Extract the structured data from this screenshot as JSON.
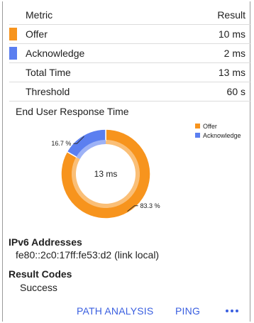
{
  "table": {
    "header": {
      "metric": "Metric",
      "result": "Result"
    },
    "rows": [
      {
        "label": "Offer",
        "value": "10 ms",
        "swatch": "#f7941d"
      },
      {
        "label": "Acknowledge",
        "value": "2 ms",
        "swatch": "#5b7ff0"
      },
      {
        "label": "Total Time",
        "value": "13 ms",
        "swatch": ""
      },
      {
        "label": "Threshold",
        "value": "60 s",
        "swatch": ""
      }
    ]
  },
  "chart_section": {
    "title": "End User Response Time"
  },
  "chart_data": {
    "type": "pie",
    "donut": true,
    "center_label": "13 ms",
    "series": [
      {
        "name": "Offer",
        "value": 83.3,
        "label": "83.3 %",
        "color": "#f7941d"
      },
      {
        "name": "Acknowledge",
        "value": 16.7,
        "label": "16.7 %",
        "color": "#5b7ff0"
      }
    ],
    "legend_position": "top-right"
  },
  "ipv6": {
    "title": "IPv6 Addresses",
    "value": "fe80::2c0:17ff:fe53:d2 (link local)"
  },
  "result_codes": {
    "title": "Result Codes",
    "value": "Success"
  },
  "footer": {
    "path_analysis_label": "PATH ANALYSIS",
    "ping_label": "PING",
    "more_icon": "more-dots-icon"
  }
}
